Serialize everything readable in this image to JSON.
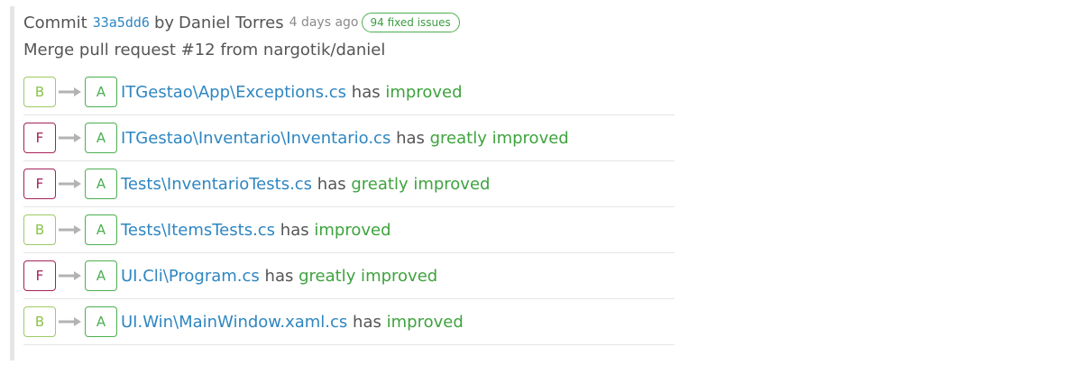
{
  "commit": {
    "prefix": "Commit",
    "hash": "33a5dd6",
    "by": "by",
    "author": "Daniel Torres",
    "time_ago": "4 days ago",
    "issues_badge": "94 fixed issues",
    "message": "Merge pull request #12 from nargotik/daniel"
  },
  "colors": {
    "grade_a": "#4caf50",
    "grade_b": "#8bc34a",
    "grade_f": "#a3235a",
    "link": "#2e86c1",
    "status": "#3ea33e"
  },
  "changes": [
    {
      "from_grade": "B",
      "to_grade": "A",
      "file": "ITGestao\\App\\Exceptions.cs",
      "has": "has",
      "status": "improved"
    },
    {
      "from_grade": "F",
      "to_grade": "A",
      "file": "ITGestao\\Inventario\\Inventario.cs",
      "has": "has",
      "status": "greatly improved"
    },
    {
      "from_grade": "F",
      "to_grade": "A",
      "file": "Tests\\InventarioTests.cs",
      "has": "has",
      "status": "greatly improved"
    },
    {
      "from_grade": "B",
      "to_grade": "A",
      "file": "Tests\\ItemsTests.cs",
      "has": "has",
      "status": "improved"
    },
    {
      "from_grade": "F",
      "to_grade": "A",
      "file": "UI.Cli\\Program.cs",
      "has": "has",
      "status": "greatly improved"
    },
    {
      "from_grade": "B",
      "to_grade": "A",
      "file": "UI.Win\\MainWindow.xaml.cs",
      "has": "has",
      "status": "improved"
    }
  ],
  "icons": {
    "arrow": "right-arrow-icon"
  }
}
